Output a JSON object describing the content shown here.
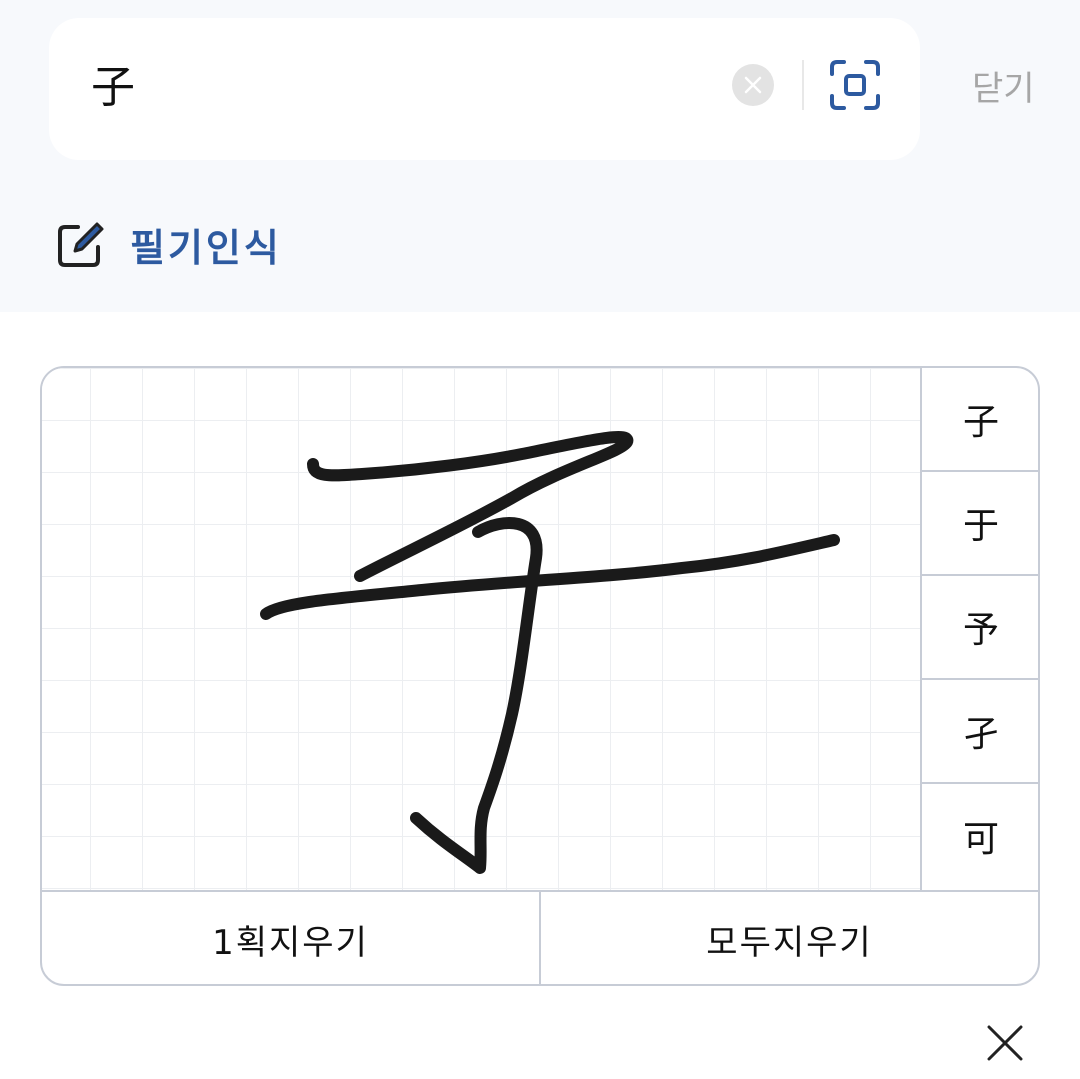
{
  "search": {
    "value": "子",
    "clear_icon": "clear-circle-icon",
    "scan_icon": "scan-icon"
  },
  "header": {
    "close_label": "닫기"
  },
  "handwriting": {
    "label": "필기인식",
    "icon": "edit-pen-icon",
    "candidates": [
      "子",
      "于",
      "予",
      "孑",
      "可"
    ],
    "undo_stroke_label": "1획지우기",
    "clear_all_label": "모두지우기"
  },
  "colors": {
    "accent": "#2d5aa0",
    "border": "#c7ccd6",
    "top_background": "#f7f9fc",
    "ink": "#1a1a1a"
  },
  "footer": {
    "close_icon": "close-x-icon"
  }
}
